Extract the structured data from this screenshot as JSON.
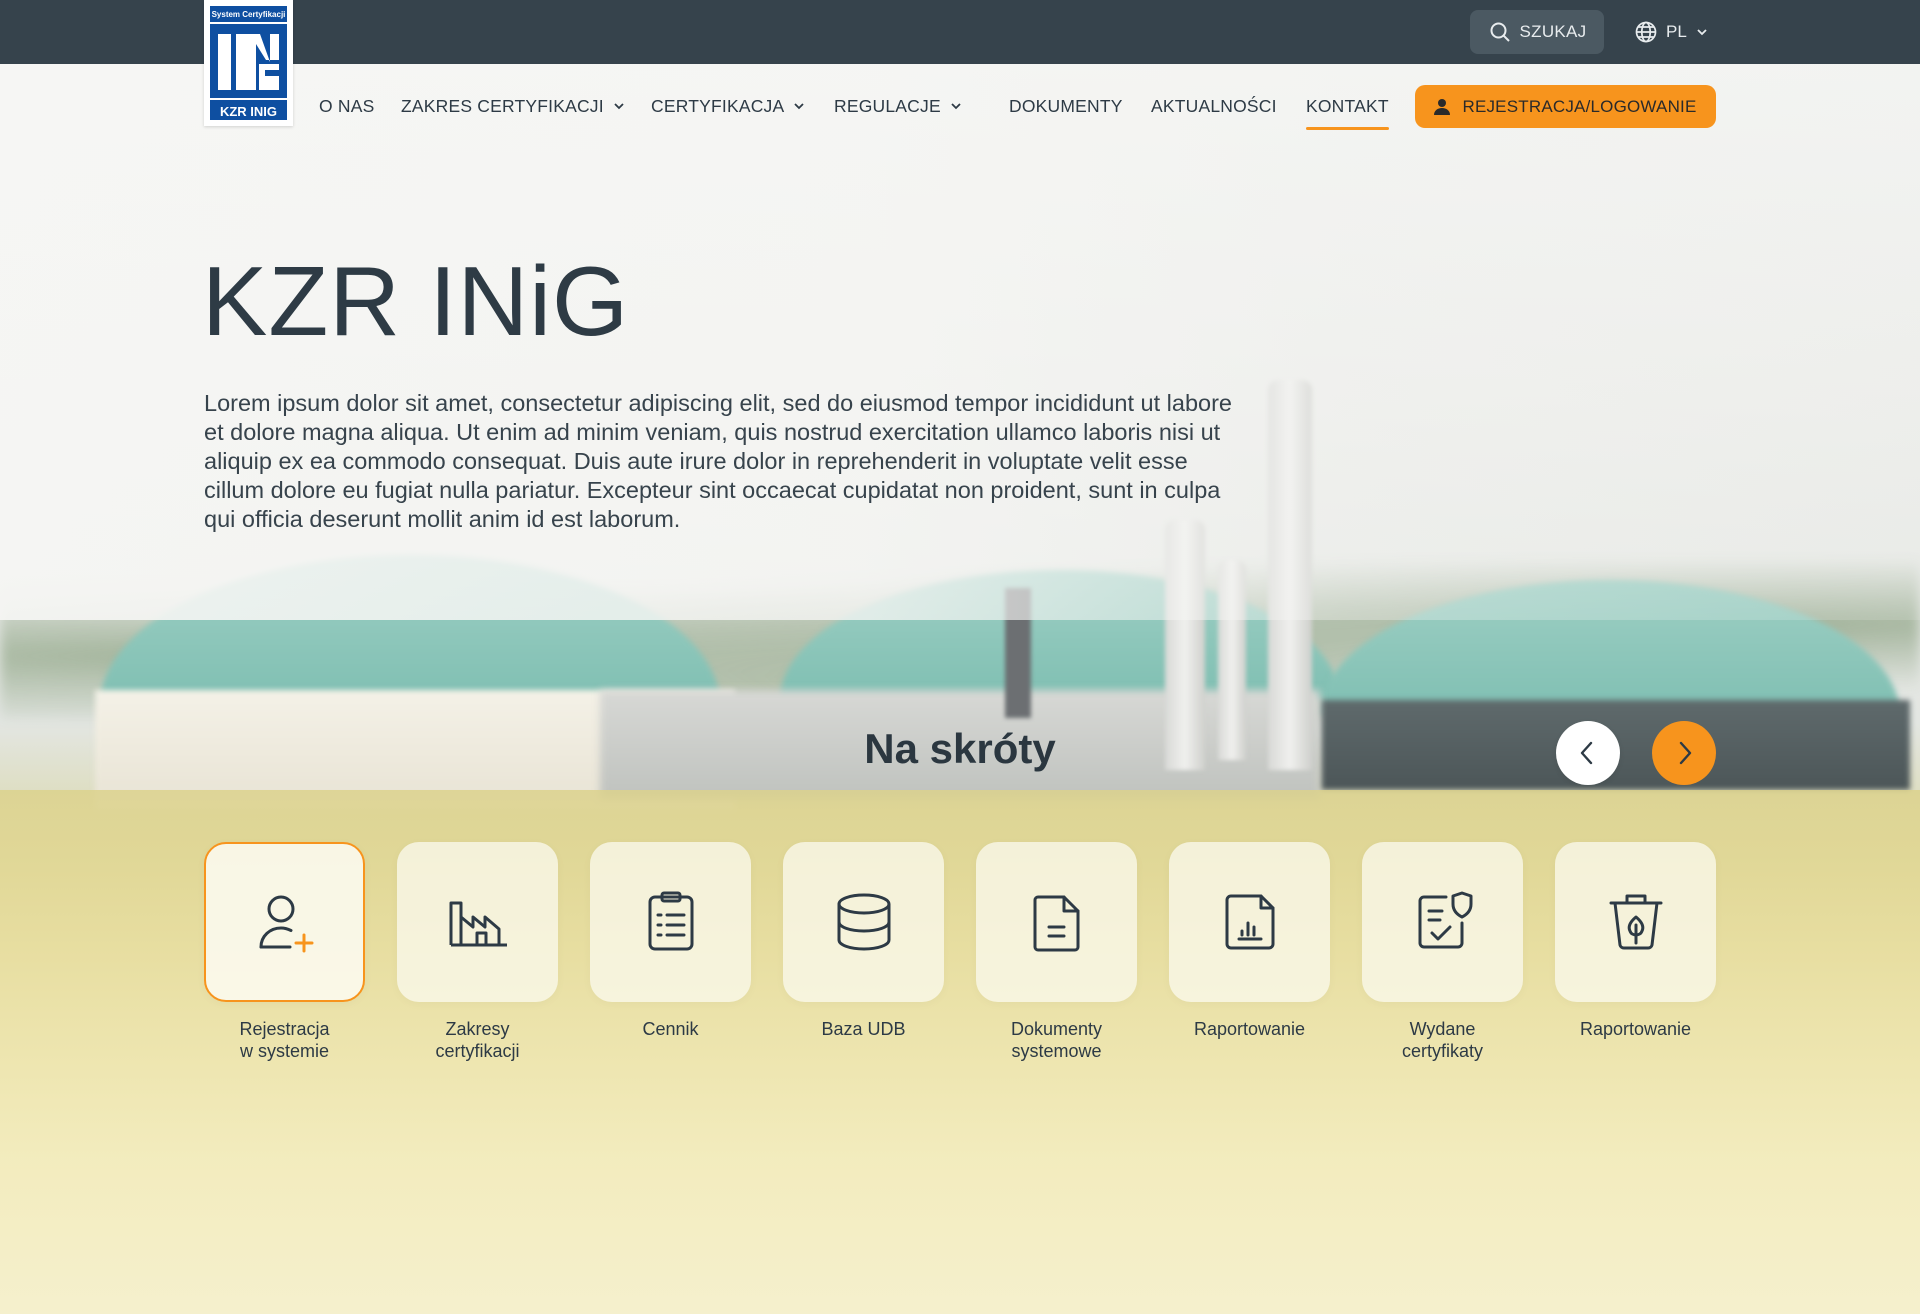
{
  "topbar": {
    "search_label": "SZUKAJ",
    "search_icon": "search-icon",
    "language": "PL",
    "language_icon": "globe-icon"
  },
  "logo": {
    "top_text": "System Certyfikacji",
    "bottom_text": "KZR INiG"
  },
  "nav": {
    "items": [
      {
        "label": "O NAS",
        "dropdown": false
      },
      {
        "label": "ZAKRES CERTYFIKACJI",
        "dropdown": true
      },
      {
        "label": "CERTYFIKACJA",
        "dropdown": true
      },
      {
        "label": "REGULACJE",
        "dropdown": true
      },
      {
        "label": "DOKUMENTY",
        "dropdown": false
      },
      {
        "label": "AKTUALNOŚCI",
        "dropdown": false
      },
      {
        "label": "KONTAKT",
        "dropdown": false,
        "active": true
      }
    ],
    "cta_label": "REJESTRACJA/LOGOWANIE",
    "cta_icon": "user-icon"
  },
  "hero": {
    "title": "KZR INiG",
    "text": "Lorem ipsum dolor sit amet, consectetur adipiscing elit, sed do eiusmod tempor incididunt ut labore et dolore magna aliqua. Ut enim ad minim veniam, quis nostrud exercitation ullamco laboris nisi ut aliquip ex ea commodo consequat. Duis aute irure dolor in reprehenderit in voluptate velit esse cillum dolore eu fugiat nulla pariatur. Excepteur sint occaecat cupidatat non proident, sunt in culpa qui officia deserunt mollit anim id est laborum."
  },
  "shortcuts": {
    "title": "Na skróty",
    "prev_icon": "chevron-left-icon",
    "next_icon": "chevron-right-icon",
    "items": [
      {
        "label": "Rejestracja\nw systemie",
        "icon": "user-add-icon",
        "selected": true
      },
      {
        "label": "Zakresy\ncertyfikacji",
        "icon": "factory-icon"
      },
      {
        "label": "Cennik",
        "icon": "clipboard-list-icon"
      },
      {
        "label": "Baza UDB",
        "icon": "database-icon"
      },
      {
        "label": "Dokumenty\nsystemowe",
        "icon": "document-icon"
      },
      {
        "label": "Raportowanie",
        "icon": "report-chart-icon"
      },
      {
        "label": "Wydane\ncertyfikaty",
        "icon": "certificate-icon"
      },
      {
        "label": "Raportowanie",
        "icon": "recycle-bin-icon"
      }
    ]
  },
  "colors": {
    "accent": "#f7941d",
    "topbar": "#36434c",
    "text": "#2d3a45",
    "logo_blue": "#0e4fa1"
  }
}
